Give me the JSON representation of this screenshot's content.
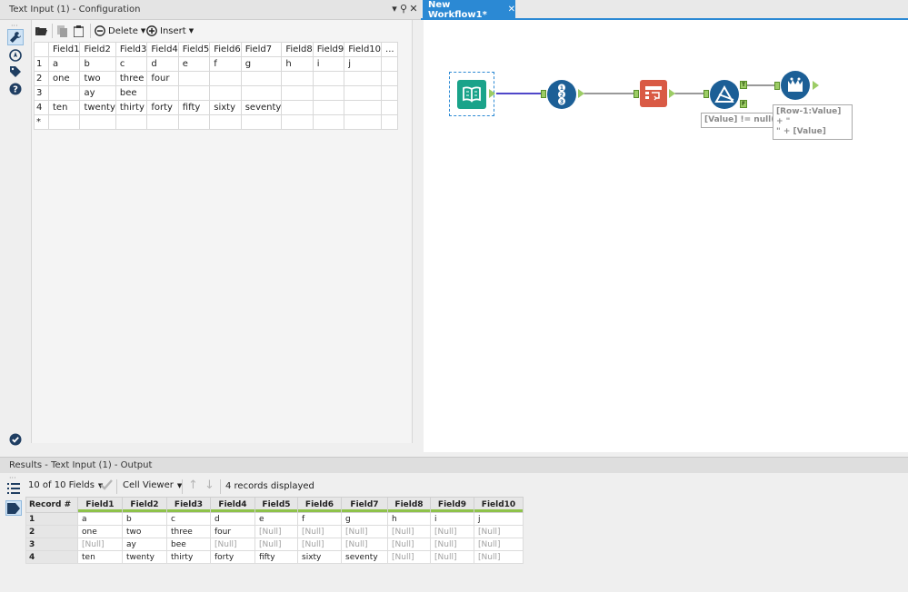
{
  "config_panel": {
    "title": "Text Input (1) - Configuration",
    "pin_label": "▾ ⚑",
    "close_label": "✕",
    "toolbar": {
      "delete_label": "Delete",
      "insert_label": "Insert"
    },
    "grid": {
      "headers": [
        "Field1",
        "Field2",
        "Field3",
        "Field4",
        "Field5",
        "Field6",
        "Field7",
        "Field8",
        "Field9",
        "Field10",
        "..."
      ],
      "rows": [
        {
          "num": "1",
          "cells": [
            "a",
            "b",
            "c",
            "d",
            "e",
            "f",
            "g",
            "h",
            "i",
            "j",
            ""
          ]
        },
        {
          "num": "2",
          "cells": [
            "one",
            "two",
            "three",
            "four",
            "",
            "",
            "",
            "",
            "",
            "",
            ""
          ]
        },
        {
          "num": "3",
          "cells": [
            "",
            "ay",
            "bee",
            "",
            "",
            "",
            "",
            "",
            "",
            "",
            ""
          ]
        },
        {
          "num": "4",
          "cells": [
            "ten",
            "twenty",
            "thirty",
            "forty",
            "fifty",
            "sixty",
            "seventy",
            "",
            "",
            "",
            ""
          ]
        },
        {
          "num": "*",
          "cells": [
            "",
            "",
            "",
            "",
            "",
            "",
            "",
            "",
            "",
            "",
            ""
          ]
        }
      ]
    }
  },
  "workflow": {
    "tab_label": "New Workflow1*",
    "tab_close": "✕",
    "annotations": {
      "filter": "[Value] != null()",
      "formula_line1": "[Row-1:Value] + \"",
      "formula_line2": "\" + [Value]"
    },
    "anchor_labels": {
      "true": "T",
      "false": "F"
    }
  },
  "results": {
    "title": "Results - Text Input (1) - Output",
    "fields_selector": "10 of 10 Fields",
    "cell_viewer": "Cell Viewer",
    "records_displayed": "4 records displayed",
    "columns": [
      "Record #",
      "Field1",
      "Field2",
      "Field3",
      "Field4",
      "Field5",
      "Field6",
      "Field7",
      "Field8",
      "Field9",
      "Field10"
    ],
    "rows": [
      {
        "num": "1",
        "cells": [
          "a",
          "b",
          "c",
          "d",
          "e",
          "f",
          "g",
          "h",
          "i",
          "j"
        ]
      },
      {
        "num": "2",
        "cells": [
          "one",
          "two",
          "three",
          "four",
          "[Null]",
          "[Null]",
          "[Null]",
          "[Null]",
          "[Null]",
          "[Null]"
        ]
      },
      {
        "num": "3",
        "cells": [
          "[Null]",
          "ay",
          "bee",
          "[Null]",
          "[Null]",
          "[Null]",
          "[Null]",
          "[Null]",
          "[Null]",
          "[Null]"
        ]
      },
      {
        "num": "4",
        "cells": [
          "ten",
          "twenty",
          "thirty",
          "forty",
          "fifty",
          "sixty",
          "seventy",
          "[Null]",
          "[Null]",
          "[Null]"
        ]
      }
    ]
  },
  "colors": {
    "accent": "#2b89d4",
    "input_tool": "#1aa38a",
    "record_id_tool": "#1c5f96",
    "select_tool": "#d95a45",
    "anchor_green": "#9ccc65",
    "connection": "#4f47c9"
  },
  "icons": [
    "wrench-icon",
    "compass-icon",
    "tag-icon",
    "help-icon",
    "check-circle-icon",
    "open-folder-icon",
    "copy-icon",
    "paste-icon",
    "minus-circle-icon",
    "plus-circle-icon",
    "list-icon",
    "tag-arrow-icon"
  ]
}
